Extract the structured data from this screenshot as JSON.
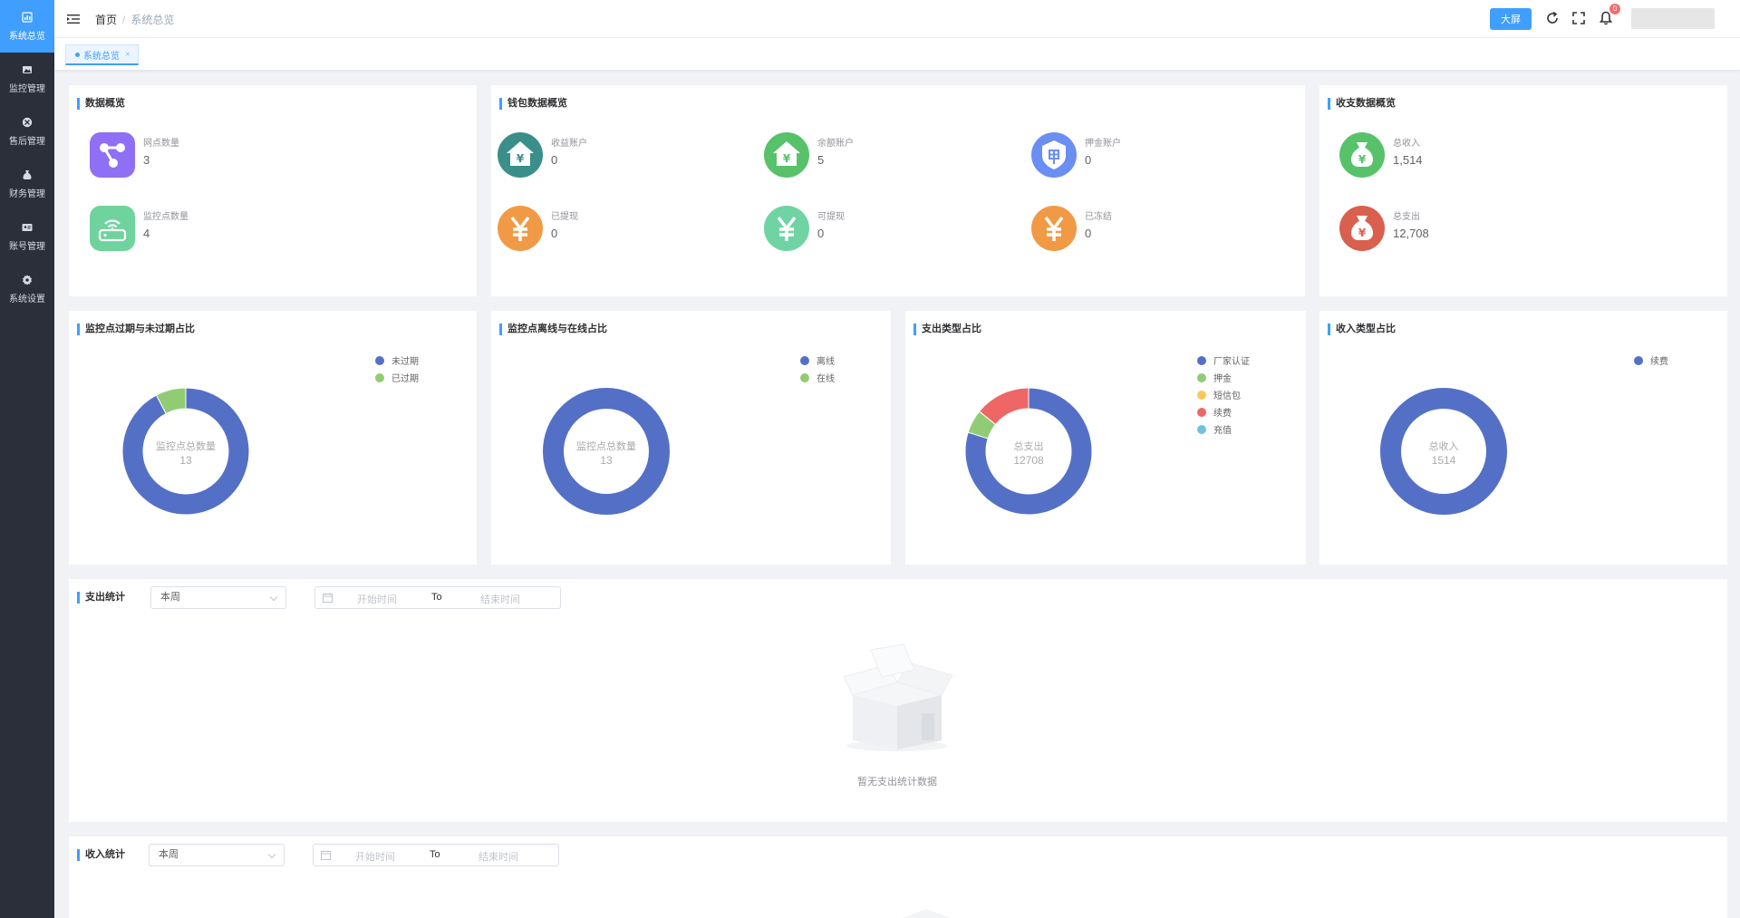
{
  "sidebar": {
    "items": [
      {
        "label": "系统总览",
        "icon": "chart-icon",
        "active": true
      },
      {
        "label": "监控管理",
        "icon": "image-icon",
        "active": false
      },
      {
        "label": "售后管理",
        "icon": "tools-icon",
        "active": false
      },
      {
        "label": "财务管理",
        "icon": "moneybag-icon",
        "active": false
      },
      {
        "label": "账号管理",
        "icon": "idcard-icon",
        "active": false
      },
      {
        "label": "系统设置",
        "icon": "gear-icon",
        "active": false
      }
    ]
  },
  "header": {
    "breadcrumb_home": "首页",
    "breadcrumb_sep": "/",
    "breadcrumb_current": "系统总览",
    "bigscreen_label": "大屏",
    "notify_count": "0"
  },
  "tabs": [
    {
      "label": "系统总览",
      "close": "×"
    }
  ],
  "colors": {
    "accent": "#409eff",
    "blue": "#5470c6",
    "green": "#91cc75",
    "yellow": "#fac858",
    "red": "#ee6666",
    "cyan": "#73c0de"
  },
  "overview": {
    "title": "数据概览",
    "items": [
      {
        "label": "网点数量",
        "value": "3",
        "icon": "network-icon",
        "color": "#8f6ff3"
      },
      {
        "label": "监控点数量",
        "value": "4",
        "icon": "router-icon",
        "color": "#6fd39d"
      }
    ]
  },
  "wallet": {
    "title": "钱包数据概览",
    "items": [
      {
        "label": "收益账户",
        "value": "0",
        "icon": "house-yuan-icon",
        "color": "#3a8f8a"
      },
      {
        "label": "余额账户",
        "value": "5",
        "icon": "house-yuan-icon",
        "color": "#58c26b"
      },
      {
        "label": "押金账户",
        "value": "0",
        "icon": "deposit-icon",
        "color": "#6b8ef2"
      },
      {
        "label": "已提现",
        "value": "0",
        "icon": "yuan-icon",
        "color": "#f19a45"
      },
      {
        "label": "可提现",
        "value": "0",
        "icon": "yuan-icon",
        "color": "#6fd3a3"
      },
      {
        "label": "已冻结",
        "value": "0",
        "icon": "yuan-icon",
        "color": "#f19a45"
      }
    ]
  },
  "finance": {
    "title": "收支数据概览",
    "items": [
      {
        "label": "总收入",
        "value": "1,514",
        "icon": "moneybag-icon",
        "color": "#58c26b"
      },
      {
        "label": "总支出",
        "value": "12,708",
        "icon": "moneybag-icon",
        "color": "#d9604e"
      }
    ]
  },
  "chart_data": [
    {
      "type": "pie",
      "title": "监控点过期与未过期占比",
      "center_label": "监控点总数量",
      "center_value": "13",
      "series": [
        {
          "name": "未过期",
          "value": 12,
          "color": "#5470c6"
        },
        {
          "name": "已过期",
          "value": 1,
          "color": "#91cc75"
        }
      ]
    },
    {
      "type": "pie",
      "title": "监控点离线与在线占比",
      "center_label": "监控点总数量",
      "center_value": "13",
      "series": [
        {
          "name": "离线",
          "value": 13,
          "color": "#5470c6"
        },
        {
          "name": "在线",
          "value": 0,
          "color": "#91cc75"
        }
      ]
    },
    {
      "type": "pie",
      "title": "支出类型占比",
      "center_label": "总支出",
      "center_value": "12708",
      "series": [
        {
          "name": "厂家认证",
          "value": 10146,
          "color": "#5470c6"
        },
        {
          "name": "押金",
          "value": 762,
          "color": "#91cc75"
        },
        {
          "name": "短信包",
          "value": 0,
          "color": "#fac858"
        },
        {
          "name": "续费",
          "value": 1800,
          "color": "#ee6666"
        },
        {
          "name": "充值",
          "value": 0,
          "color": "#73c0de"
        }
      ]
    },
    {
      "type": "pie",
      "title": "收入类型占比",
      "center_label": "总收入",
      "center_value": "1514",
      "series": [
        {
          "name": "续费",
          "value": 1514,
          "color": "#5470c6"
        }
      ]
    }
  ],
  "expense_stats": {
    "title": "支出统计",
    "period": "本周",
    "start_placeholder": "开始时间",
    "to": "To",
    "end_placeholder": "结束时间",
    "empty_text": "暂无支出统计数据"
  },
  "income_stats": {
    "title": "收入统计",
    "period": "本周",
    "start_placeholder": "开始时间",
    "to": "To",
    "end_placeholder": "结束时间"
  }
}
